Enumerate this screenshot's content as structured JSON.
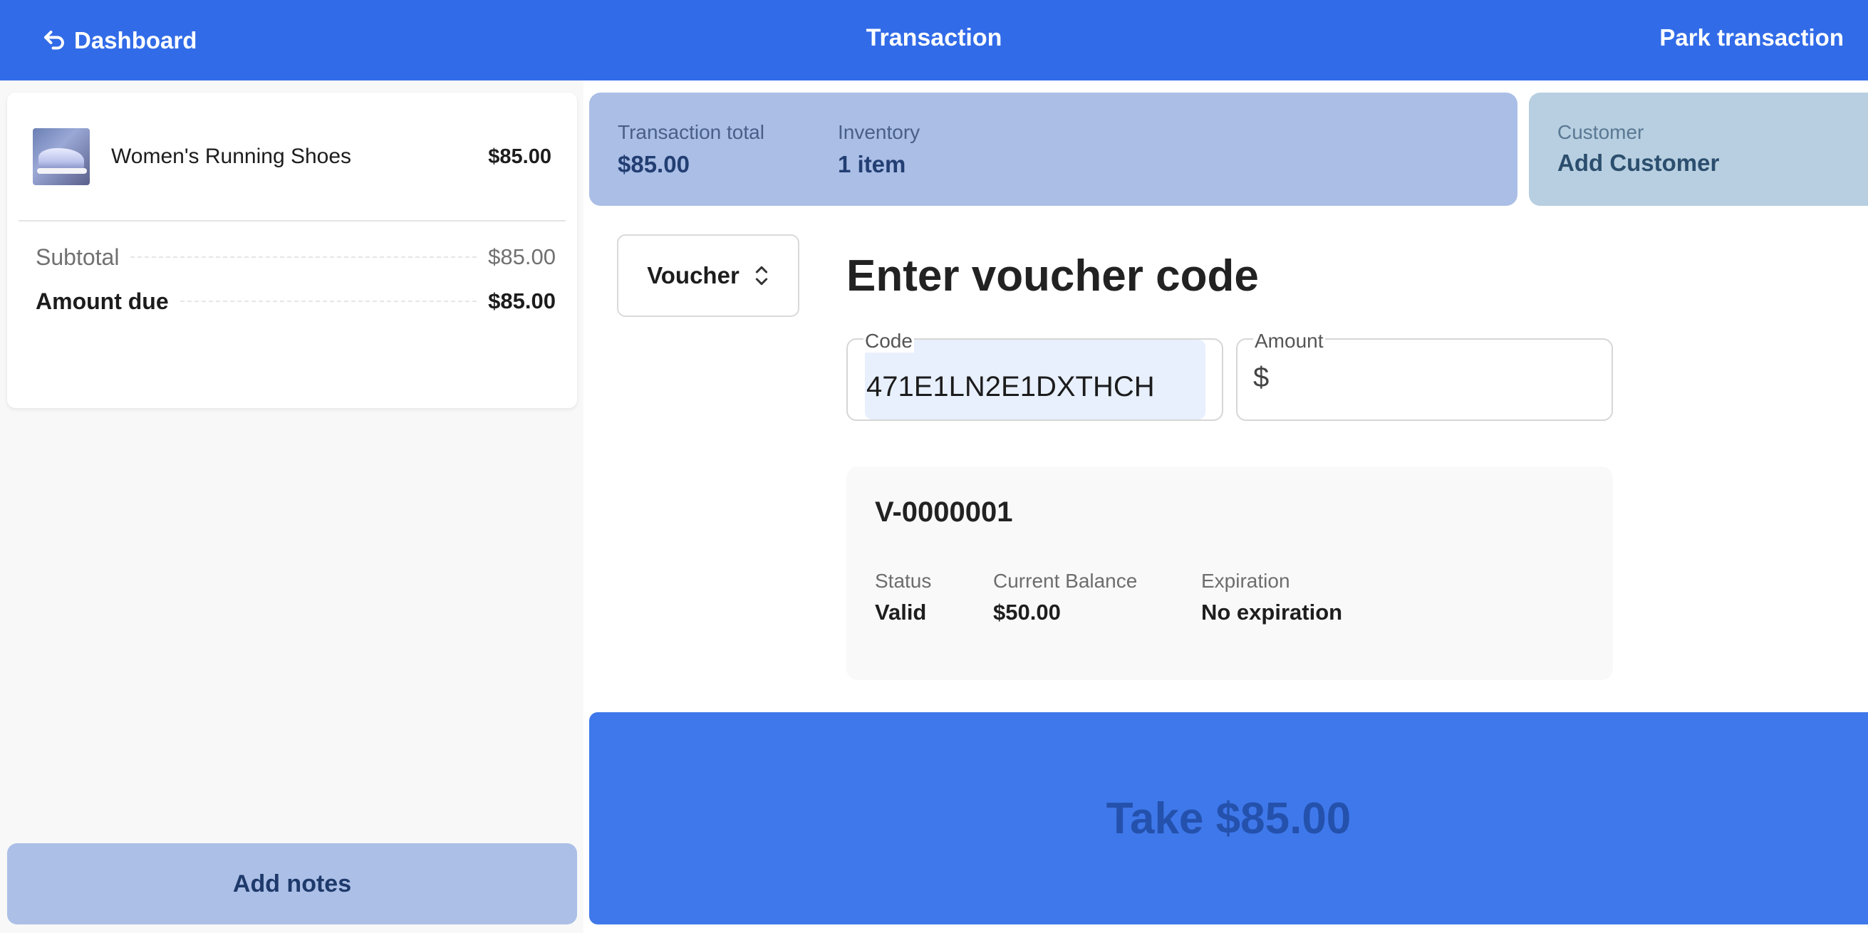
{
  "header": {
    "back_label": "Dashboard",
    "title": "Transaction",
    "park_label": "Park transaction"
  },
  "cart": {
    "items": [
      {
        "name": "Women's Running Shoes",
        "price": "$85.00",
        "image_icon": "running-shoe-photo"
      }
    ],
    "subtotal_label": "Subtotal",
    "subtotal_value": "$85.00",
    "amount_due_label": "Amount due",
    "amount_due_value": "$85.00",
    "notes_label": "Add notes"
  },
  "summary": {
    "total_label": "Transaction total",
    "total_value": "$85.00",
    "inventory_label": "Inventory",
    "inventory_value": "1 item",
    "customer_label": "Customer",
    "customer_value": "Add Customer"
  },
  "payment": {
    "method": "Voucher",
    "heading": "Enter voucher code",
    "code_label": "Code",
    "code_value": "471E1LN2E1DXTHCH",
    "amount_label": "Amount",
    "amount_currency": "$",
    "amount_value": ""
  },
  "voucher": {
    "id": "V-0000001",
    "status_label": "Status",
    "status_value": "Valid",
    "balance_label": "Current Balance",
    "balance_value": "$50.00",
    "expiration_label": "Expiration",
    "expiration_value": "No expiration"
  },
  "take_button_label": "Take $85.00",
  "colors": {
    "primary": "#316be8",
    "take_button": "#3f78ea",
    "summary_card": "#aabee6",
    "customer_card": "#b7cfe0",
    "autofill_highlight": "#e8f0fe"
  }
}
